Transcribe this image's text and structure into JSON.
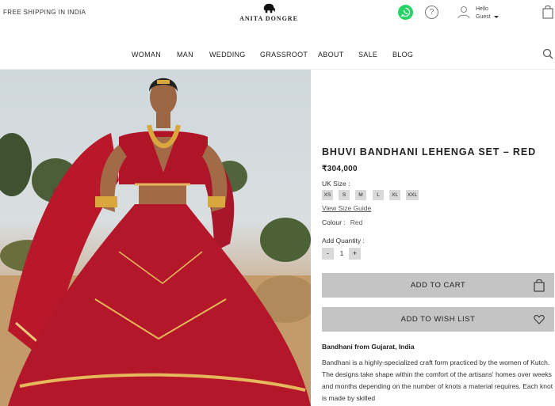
{
  "header": {
    "shipping_text": "FREE SHIPPING IN INDIA",
    "brand": "ANITA DONGRE",
    "hello": "Hello",
    "guest": "Guest",
    "help_glyph": "?"
  },
  "nav": {
    "items": [
      "WOMAN",
      "MAN",
      "WEDDING",
      "GRASSROOT",
      "ABOUT",
      "SALE",
      "BLOG"
    ]
  },
  "product": {
    "title": "BHUVI BANDHANI LEHENGA SET – RED",
    "price": "₹304,000",
    "size_label": "UK Size :",
    "sizes": [
      "XS",
      "S",
      "M",
      "L",
      "XL",
      "XXL"
    ],
    "size_guide": "View Size Guide",
    "colour_label": "Colour :",
    "colour_value": "Red",
    "quantity_label": "Add Quantity :",
    "quantity_minus": "-",
    "quantity_value": "1",
    "quantity_plus": "+",
    "add_to_cart": "ADD TO CART",
    "add_to_wishlist": "ADD TO WISH LIST",
    "description_heading": "Bandhani from Gujarat, India",
    "description": "Bandhani is a highly-specialized craft form practiced by the women of Kutch. The designs take shape within the comfort of the artisans' homes over weeks and months depending on the number of knots a material requires. Each knot is made by skilled"
  },
  "colors": {
    "whatsapp": "#25d366",
    "button_bg": "#c4c4c4",
    "chip_bg": "#d9d9d9",
    "lehenga_red": "#b5172a"
  },
  "icons": [
    "brand-elephant-icon",
    "whatsapp-icon",
    "help-icon",
    "user-icon",
    "chevron-down-icon",
    "shopping-bag-icon",
    "search-icon",
    "cart-bag-icon",
    "heart-icon"
  ]
}
